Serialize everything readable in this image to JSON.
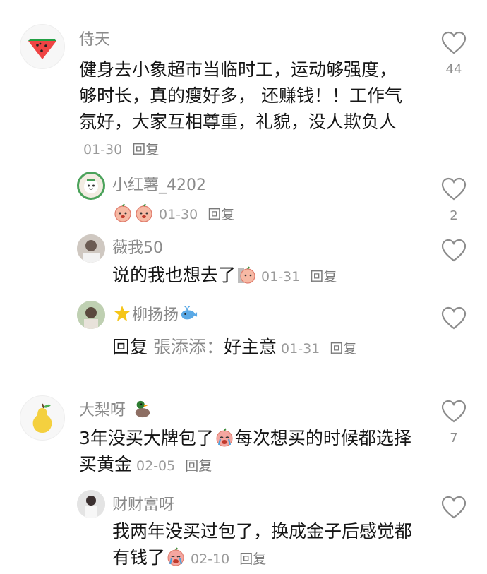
{
  "comments": [
    {
      "username": "侍天",
      "text": "健身去小象超市当临时工，运动够强度，够时长，真的瘦好多， 还赚钱！！工作气氛好，大家互相尊重，礼貌，没人欺负人",
      "date": "01-30",
      "reply_label": "回复",
      "likes": "44",
      "replies": [
        {
          "username": "小红薯_4202",
          "text": "",
          "date": "01-30",
          "reply_label": "回复",
          "likes": "2"
        },
        {
          "username": "薇我50",
          "text": "说的我也想去了",
          "date": "01-31",
          "reply_label": "回复",
          "likes": ""
        },
        {
          "username": "柳扬扬",
          "reply_word": "回复",
          "reply_to": "張添添：",
          "text": "好主意",
          "date": "01-31",
          "reply_label": "回复",
          "likes": ""
        }
      ]
    },
    {
      "username": "大梨呀",
      "text_part1": "3年没买大牌包了",
      "text_part2": "每次想买的时候都选择买黄金",
      "date": "02-05",
      "reply_label": "回复",
      "likes": "7",
      "replies": [
        {
          "username": "财财富呀",
          "text": "我两年没买过包了，换成金子后感觉都有钱了",
          "date": "02-10",
          "reply_label": "回复",
          "likes": ""
        }
      ]
    }
  ],
  "icons": {
    "like": "heart-outline-icon",
    "emoji_cry": "crying-face-emoji",
    "emoji_peach": "peach-face-emoji"
  },
  "colors": {
    "name": "#8a8a8a",
    "text": "#161616",
    "meta": "#9a9a9a"
  }
}
